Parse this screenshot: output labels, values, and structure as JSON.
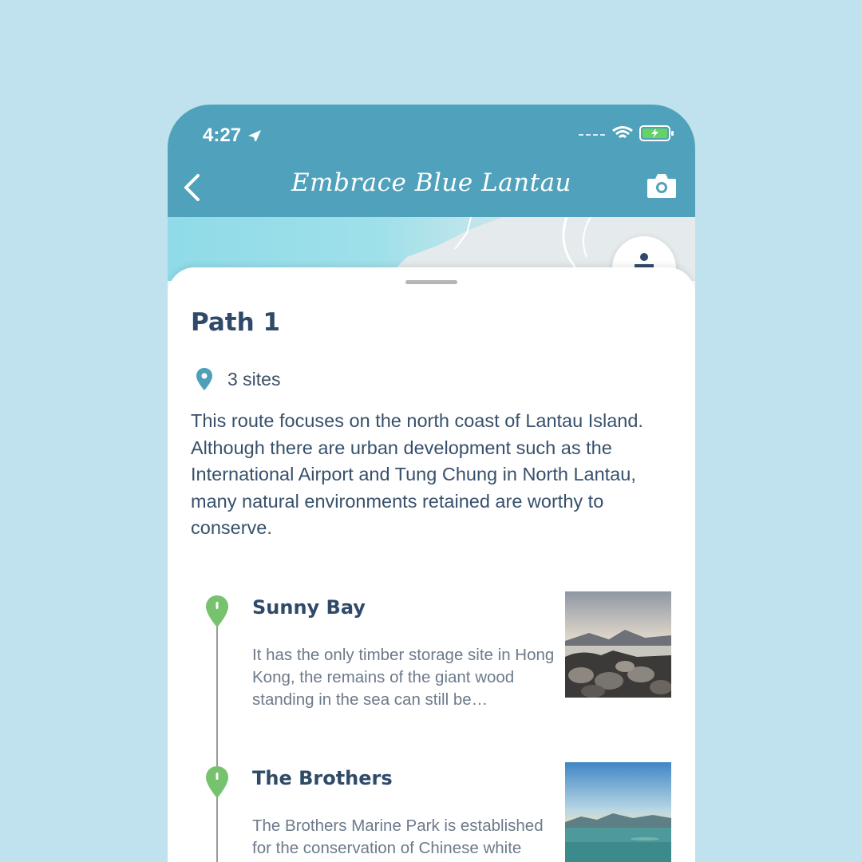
{
  "status_bar": {
    "time": "4:27"
  },
  "nav": {
    "title": "Embrace Blue Lantau"
  },
  "sheet": {
    "path_title": "Path 1",
    "sites_count": "3 sites",
    "description": "This route focuses on the north coast of Lantau Island. Although there are urban development such as the International Airport and Tung Chung in North Lantau, many natural environments retained are worthy to conserve."
  },
  "sites": [
    {
      "name": "Sunny Bay",
      "blurb": "It has the only timber storage site in Hong Kong, the remains of the giant wood standing in the sea can still be…"
    },
    {
      "name": "The Brothers",
      "blurb": "The Brothers Marine Park is established for the conservation of Chinese white dolphins and their hab"
    }
  ],
  "colors": {
    "background": "#bfe2ee",
    "header": "#50a1bb",
    "title_text": "#2f4a68",
    "site_marker": "#77c26e",
    "location_pin": "#4f9fba"
  },
  "icons": [
    "location-arrow-icon",
    "wifi-icon",
    "battery-charging-icon",
    "chevron-left-icon",
    "camera-icon",
    "person-icon",
    "map-pin-icon"
  ]
}
